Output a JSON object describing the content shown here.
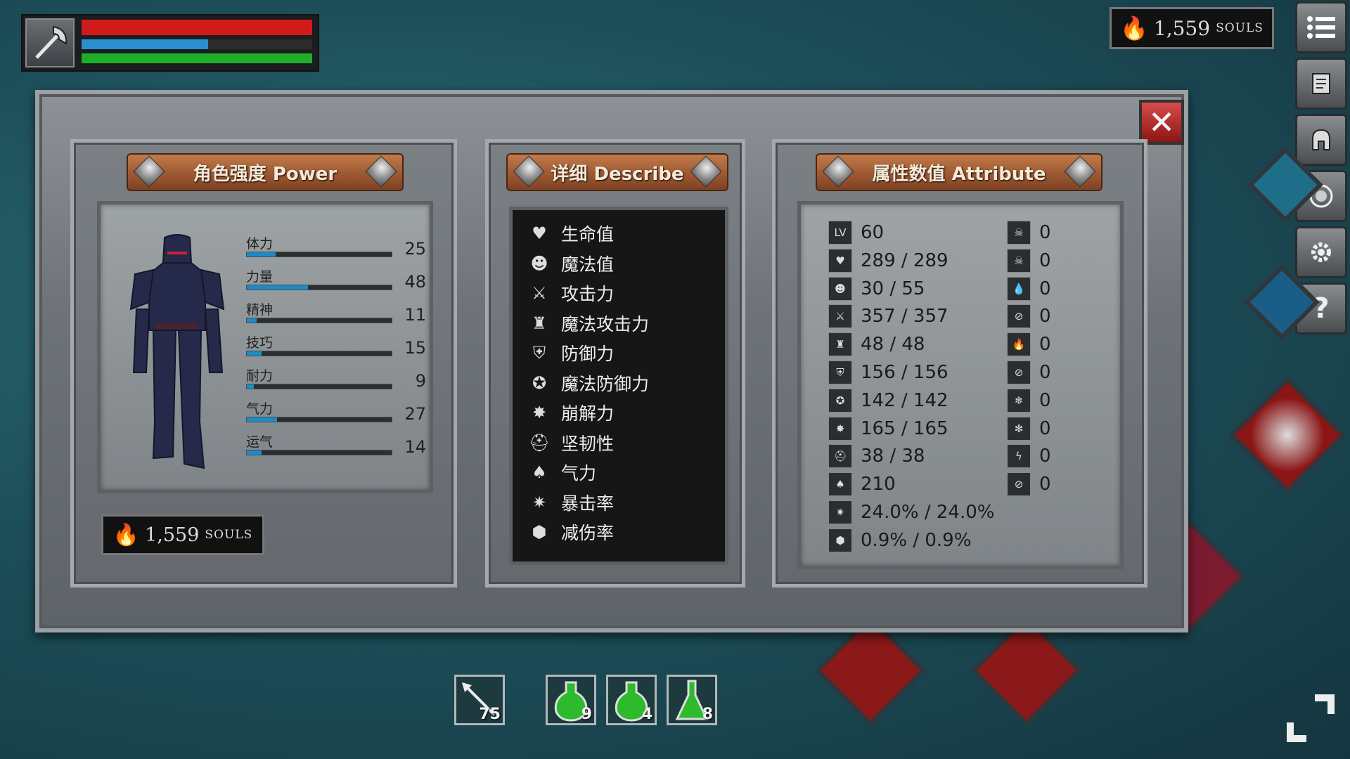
{
  "hud": {
    "portrait_icon": "battle-axe-icon",
    "bars": [
      {
        "name": "health",
        "color": "#d11b1b",
        "fill": 1.0
      },
      {
        "name": "mana",
        "color": "#2a8fd0",
        "fill": 0.55
      },
      {
        "name": "stamina",
        "color": "#1fae2a",
        "fill": 1.0
      }
    ]
  },
  "top_souls": {
    "amount": "1,559",
    "unit": "SOULS",
    "icon": "flame-icon"
  },
  "toolbar": {
    "buttons": [
      "menu-list-icon",
      "scroll-map-icon",
      "helmet-icon",
      "emblem-icon",
      "gear-icon",
      "help-icon"
    ]
  },
  "panel": {
    "close_icon": "close-x-icon",
    "power": {
      "title": "角色强度 Power",
      "stats": [
        {
          "label": "体力",
          "value": "25",
          "fraction": 0.2
        },
        {
          "label": "力量",
          "value": "48",
          "fraction": 0.42
        },
        {
          "label": "精神",
          "value": "11",
          "fraction": 0.07
        },
        {
          "label": "技巧",
          "value": "15",
          "fraction": 0.1
        },
        {
          "label": "耐力",
          "value": "9",
          "fraction": 0.05
        },
        {
          "label": "气力",
          "value": "27",
          "fraction": 0.21
        },
        {
          "label": "运气",
          "value": "14",
          "fraction": 0.1
        }
      ],
      "souls": {
        "amount": "1,559",
        "unit": "SOULS",
        "icon": "flame-icon"
      }
    },
    "describe": {
      "title": "详细 Describe",
      "items": [
        {
          "icon": "heart-icon",
          "label": "生命值"
        },
        {
          "icon": "mage-head-icon",
          "label": "魔法值"
        },
        {
          "icon": "sword-icon",
          "label": "攻击力"
        },
        {
          "icon": "magic-castle-icon",
          "label": "魔法攻击力"
        },
        {
          "icon": "shield-icon",
          "label": "防御力"
        },
        {
          "icon": "magic-shield-icon",
          "label": "魔法防御力"
        },
        {
          "icon": "break-icon",
          "label": "崩解力"
        },
        {
          "icon": "tough-helmet-icon",
          "label": "坚韧性"
        },
        {
          "icon": "lungs-icon",
          "label": "气力"
        },
        {
          "icon": "crit-star-icon",
          "label": "暴击率"
        },
        {
          "icon": "damage-reduction-icon",
          "label": "减伤率"
        }
      ]
    },
    "attribute": {
      "title": "属性数值 Attribute",
      "left": [
        {
          "icon": "LV",
          "value": "60"
        },
        {
          "icon": "heart-icon",
          "value": "289 / 289"
        },
        {
          "icon": "mage-head-icon",
          "value": "30 / 55"
        },
        {
          "icon": "sword-icon",
          "value": "357 / 357"
        },
        {
          "icon": "magic-castle-icon",
          "value": "48 / 48"
        },
        {
          "icon": "shield-icon",
          "value": "156 / 156"
        },
        {
          "icon": "magic-shield-icon",
          "value": "142 / 142"
        },
        {
          "icon": "break-icon",
          "value": "165 / 165"
        },
        {
          "icon": "tough-helmet-icon",
          "value": "38 / 38"
        },
        {
          "icon": "lungs-icon",
          "value": "210"
        },
        {
          "icon": "crit-star-icon",
          "value": "24.0% / 24.0%"
        },
        {
          "icon": "damage-reduction-icon",
          "value": "0.9% / 0.9%"
        }
      ],
      "right": [
        {
          "icon": "poison-skull-icon",
          "value": "0"
        },
        {
          "icon": "poison-resist-icon",
          "value": "0"
        },
        {
          "icon": "bleed-drop-icon",
          "value": "0"
        },
        {
          "icon": "bleed-resist-icon",
          "value": "0"
        },
        {
          "icon": "fire-icon",
          "value": "0"
        },
        {
          "icon": "fire-resist-icon",
          "value": "0"
        },
        {
          "icon": "frost-icon",
          "value": "0"
        },
        {
          "icon": "frost-resist-icon",
          "value": "0"
        },
        {
          "icon": "lightning-icon",
          "value": "0"
        },
        {
          "icon": "lightning-resist-icon",
          "value": "0"
        }
      ]
    }
  },
  "quickbar": [
    {
      "icon": "arrow-icon",
      "count": "75"
    },
    {
      "icon": "green-potion-icon",
      "count": "9"
    },
    {
      "icon": "green-potion-icon",
      "count": "4"
    },
    {
      "icon": "green-flask-icon",
      "count": "8"
    }
  ],
  "actions": [
    "dodge-roll-icon",
    "bow-attack-icon",
    "spear-attack-icon",
    "shield-block-icon",
    "eye-icon",
    "sprint-icon"
  ]
}
